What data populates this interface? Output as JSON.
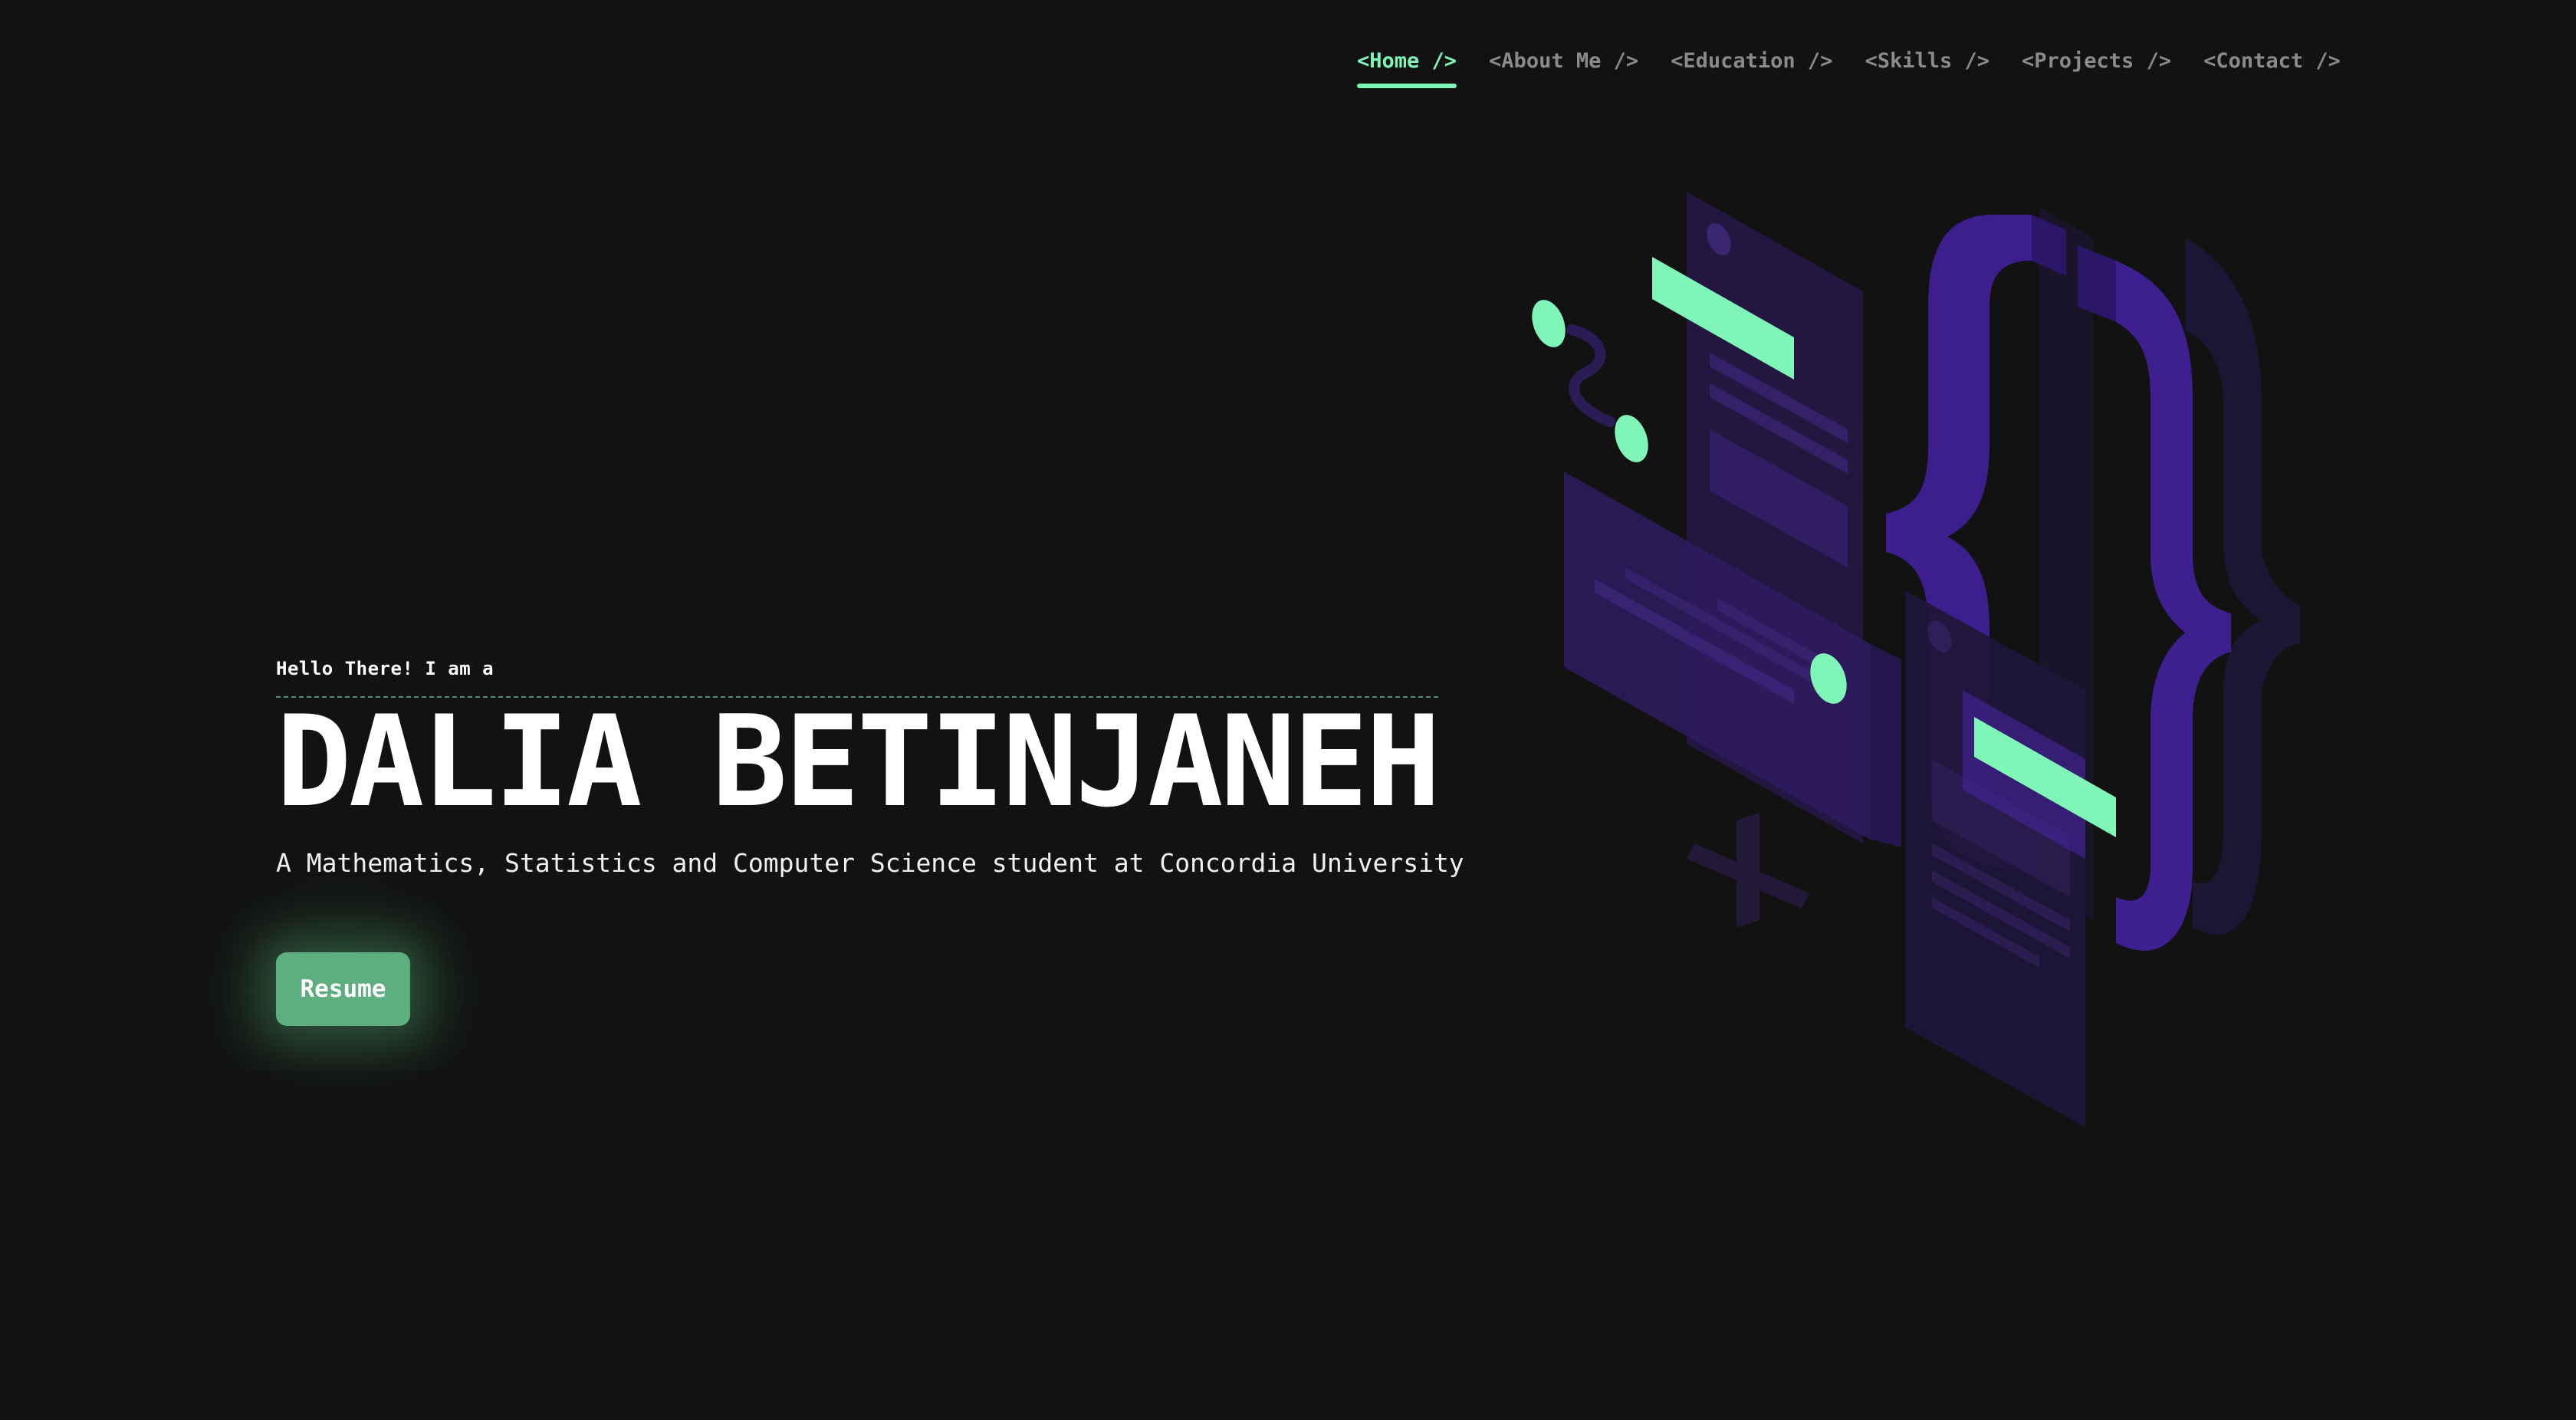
{
  "nav": {
    "items": [
      {
        "label": "<Home />",
        "active": true
      },
      {
        "label": "<About Me />",
        "active": false
      },
      {
        "label": "<Education />",
        "active": false
      },
      {
        "label": "<Skills />",
        "active": false
      },
      {
        "label": "<Projects />",
        "active": false
      },
      {
        "label": "<Contact />",
        "active": false
      }
    ]
  },
  "hero": {
    "greeting": "Hello There! I am a",
    "name": "DALIA BETINJANEH",
    "subtitle": "A Mathematics, Statistics and Computer Science student at Concordia University",
    "resume_label": "Resume"
  },
  "colors": {
    "background": "#121212",
    "accent_green": "#7ff5b8",
    "button_green": "#5fae7f",
    "purple": "#3e1f8a",
    "nav_inactive": "#8a8a8a"
  },
  "illustration": {
    "icon": "isometric-code-braces-illustration"
  }
}
